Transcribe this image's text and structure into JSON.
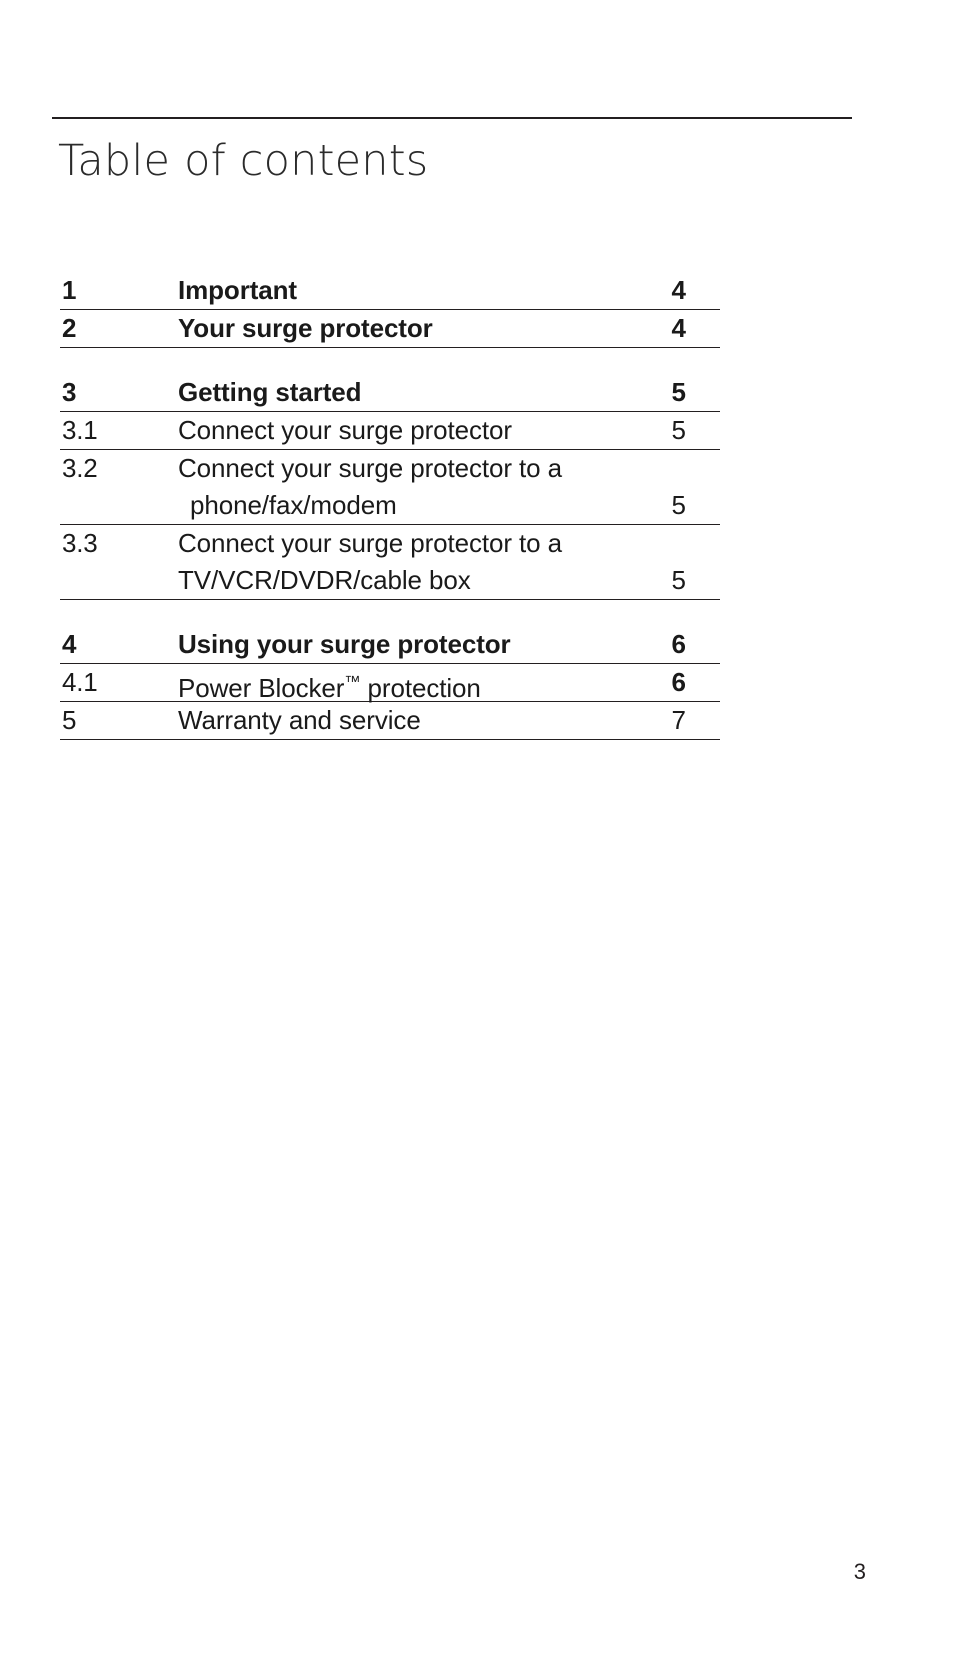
{
  "document": {
    "title": "Table of contents",
    "footer_page_number": "3",
    "rule_color": "#231f20",
    "text_color": "#1a1a1a"
  },
  "toc": {
    "groups": [
      {
        "rows": [
          {
            "number": "1",
            "lines": [
              "Important"
            ],
            "page": "4",
            "bold": true
          },
          {
            "number": "2",
            "lines": [
              "Your surge protector"
            ],
            "page": "4",
            "bold": true
          }
        ]
      },
      {
        "rows": [
          {
            "number": "3",
            "lines": [
              "Getting started"
            ],
            "page": "5",
            "bold": true
          },
          {
            "number": "3.1",
            "lines": [
              "Connect your surge protector"
            ],
            "page": "5",
            "bold": false
          },
          {
            "number": "3.2",
            "lines": [
              "Connect your surge protector to a",
              "phone/fax/modem"
            ],
            "page": "5",
            "bold": false,
            "indent_second_line": true
          },
          {
            "number": "3.3",
            "lines": [
              "Connect your surge protector to a",
              "TV/VCR/DVDR/cable box"
            ],
            "page": "5",
            "bold": false,
            "indent_second_line": false
          }
        ]
      },
      {
        "rows": [
          {
            "number": "4",
            "lines": [
              "Using your surge protector"
            ],
            "page": "6",
            "bold": true
          },
          {
            "number": "4.1",
            "lines": [
              "Power Blocker™ protection"
            ],
            "page": "6",
            "bold": false,
            "page_bold": true,
            "trademark": true
          },
          {
            "number": "5",
            "lines": [
              "Warranty and service"
            ],
            "page": "7",
            "bold": false
          }
        ]
      }
    ]
  }
}
